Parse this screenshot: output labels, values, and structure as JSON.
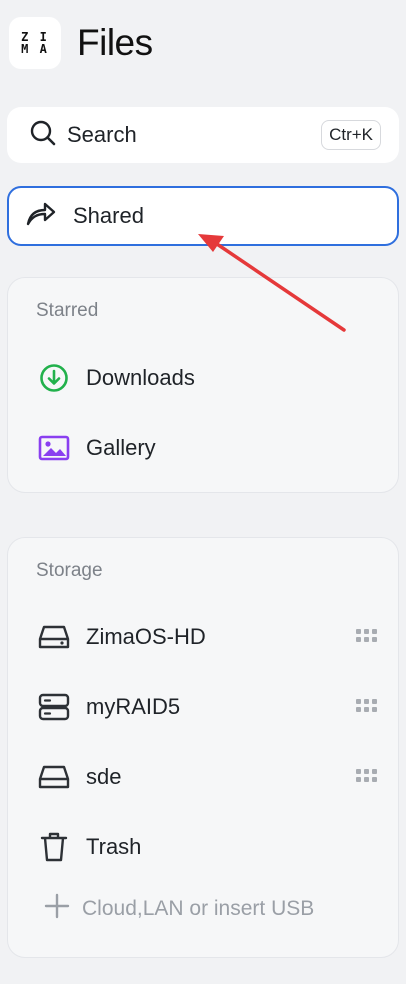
{
  "header": {
    "logo_line1": "Z I",
    "logo_line2": "M A",
    "title": "Files"
  },
  "search": {
    "label": "Search",
    "shortcut": "Ctr+K"
  },
  "shared": {
    "label": "Shared"
  },
  "starred": {
    "title": "Starred",
    "items": [
      {
        "label": "Downloads",
        "icon": "download-circle-icon",
        "color": "#22b14c"
      },
      {
        "label": "Gallery",
        "icon": "image-icon",
        "color": "#8a3ff0"
      }
    ]
  },
  "storage": {
    "title": "Storage",
    "items": [
      {
        "label": "ZimaOS-HD",
        "icon": "hard-drive-icon"
      },
      {
        "label": "myRAID5",
        "icon": "raid-server-icon"
      },
      {
        "label": "sde",
        "icon": "disk-icon"
      },
      {
        "label": "Trash",
        "icon": "trash-icon"
      }
    ],
    "add_label": "Cloud,LAN or insert USB"
  },
  "colors": {
    "accent": "#2f6fde",
    "annotation": "#e5393a"
  }
}
